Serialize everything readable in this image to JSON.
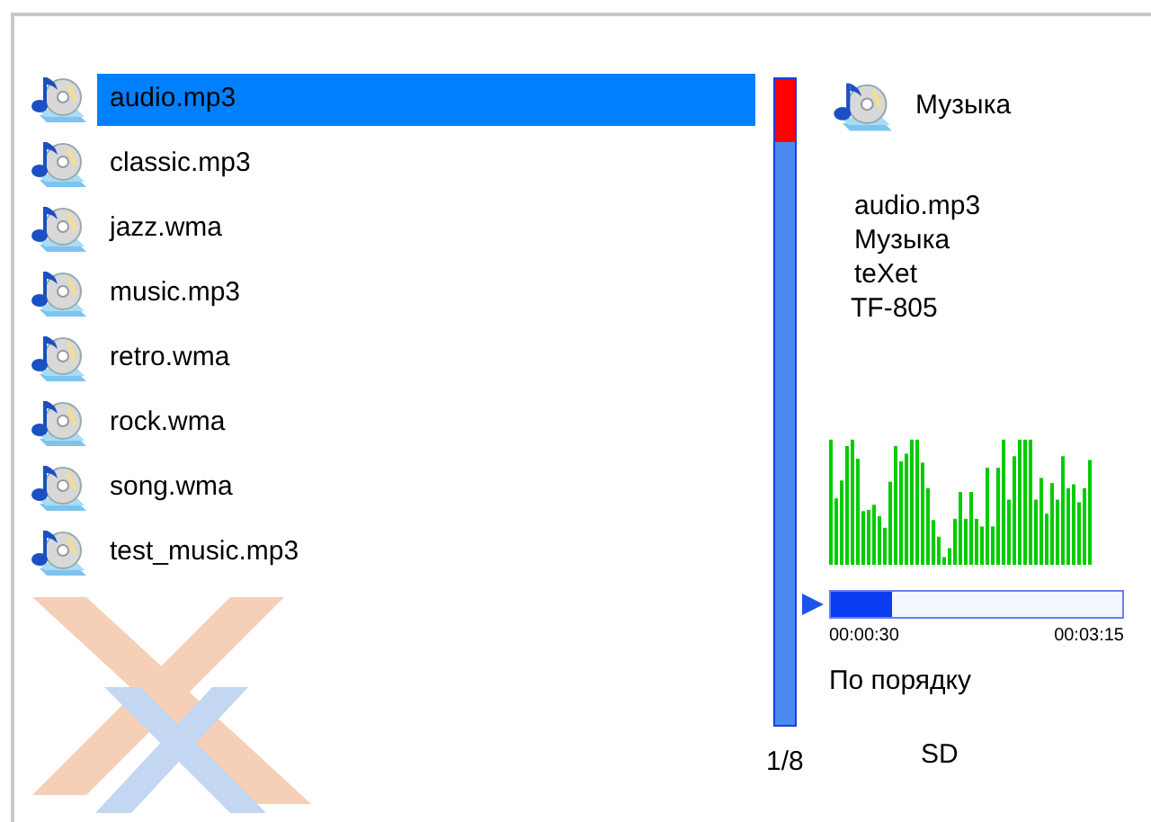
{
  "files": [
    {
      "name": "audio.mp3",
      "selected": true
    },
    {
      "name": "classic.mp3",
      "selected": false
    },
    {
      "name": "jazz.wma",
      "selected": false
    },
    {
      "name": "music.mp3",
      "selected": false
    },
    {
      "name": "retro.wma",
      "selected": false
    },
    {
      "name": "rock.wma",
      "selected": false
    },
    {
      "name": "song.wma",
      "selected": false
    },
    {
      "name": "test_music.mp3",
      "selected": false
    }
  ],
  "position": "1/8",
  "category": "Музыка",
  "track_info": [
    "audio.mp3",
    "Музыка",
    "teXet",
    "TF-805"
  ],
  "progress": {
    "level": 0.21,
    "elapsed": "00:00:30",
    "total": "00:03:15"
  },
  "play_mode": "По порядку",
  "storage": "SD"
}
